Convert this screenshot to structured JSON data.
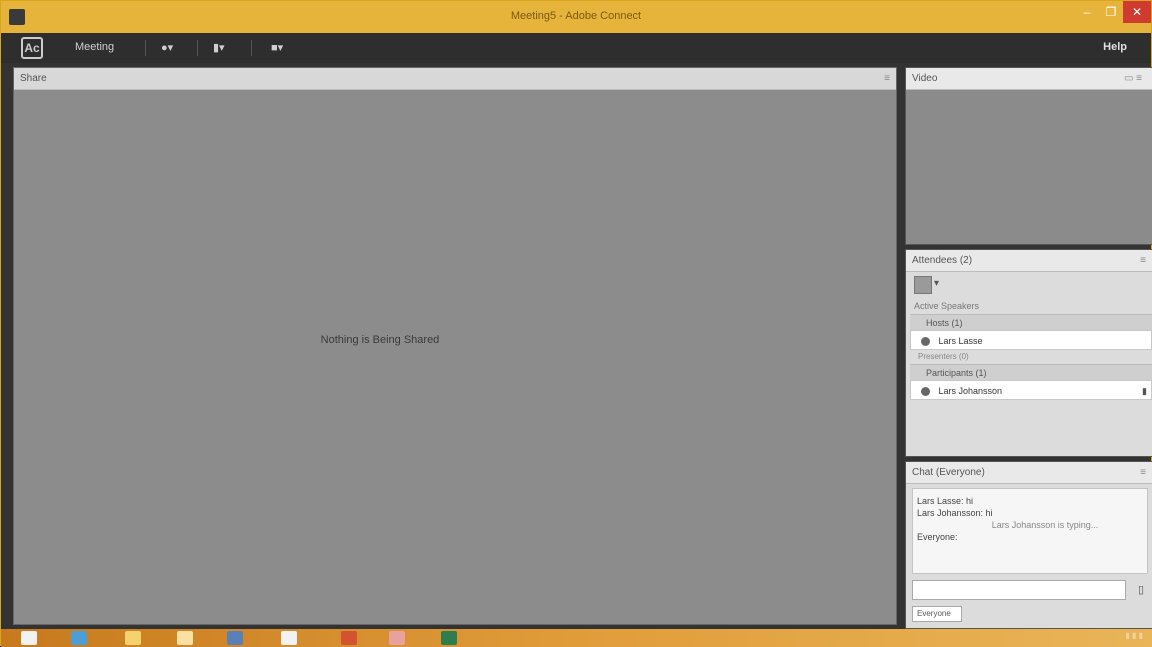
{
  "window": {
    "title": "Meeting5 - Adobe Connect"
  },
  "toolbar": {
    "logo": "Ac",
    "meeting_menu": "Meeting",
    "help_label": "Help"
  },
  "stage": {
    "panel_title": "Share",
    "empty_message": "Nothing is Being Shared"
  },
  "video": {
    "panel_title": "Video"
  },
  "attendees": {
    "panel_title": "Attendees (2)",
    "active_speakers": "Active Speakers",
    "hosts_group": "Hosts (1)",
    "host_name": "Lars Lasse",
    "presenters_group": "Presenters (0)",
    "participants_group": "Participants (1)",
    "participant_name": "Lars Johansson"
  },
  "chat": {
    "panel_title": "Chat (Everyone)",
    "lines": [
      "Lars Lasse: hi",
      "Lars Johansson: hi",
      "Lars Johansson is typing...",
      "Everyone:"
    ],
    "tab_label": "Everyone"
  },
  "taskbar": {
    "icons": [
      "windows-icon",
      "ie-icon",
      "folder-icon",
      "explorer-icon",
      "people-icon",
      "store-icon",
      "media-icon",
      "connect-icon"
    ]
  },
  "colors": {
    "accent": "#e7b43b",
    "close": "#cf3b2f",
    "stage_bg": "#8c8c8c"
  }
}
